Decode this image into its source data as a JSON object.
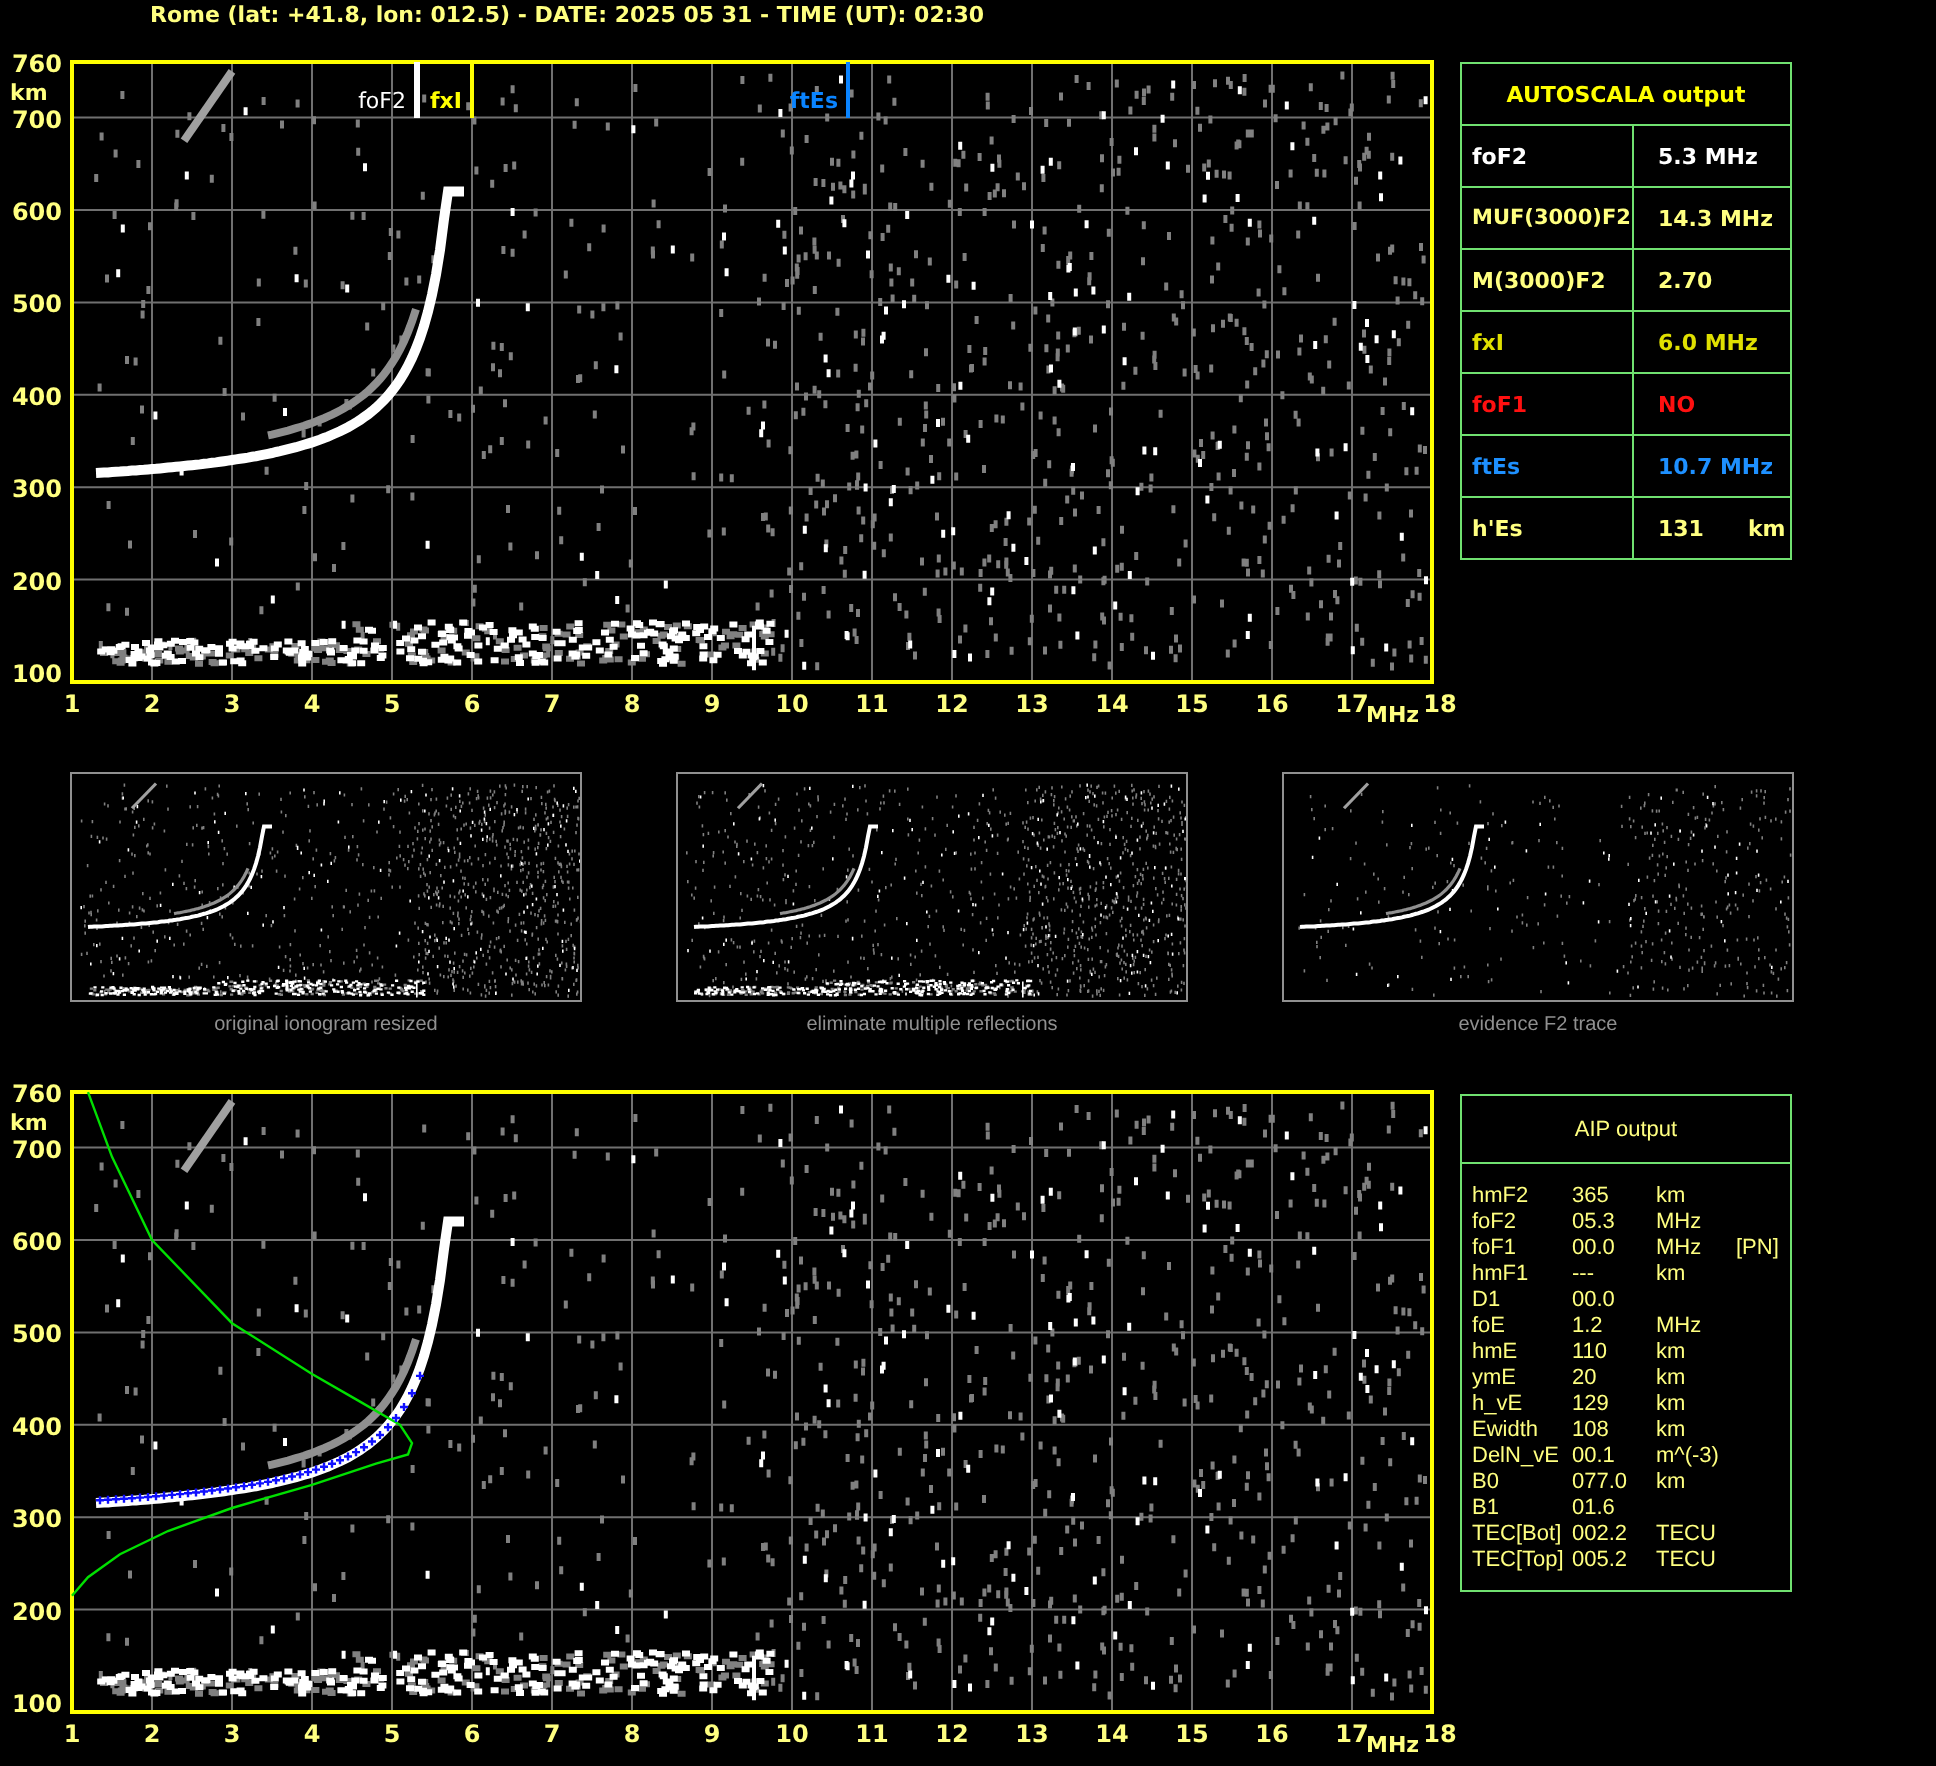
{
  "header": {
    "title": "Rome (lat: +41.8, lon: 012.5) - DATE: 2025 05 31 - TIME (UT): 02:30"
  },
  "top_plot": {
    "y_unit": "km",
    "x_unit": "MHz",
    "y_ticks": [
      "760",
      "700",
      "600",
      "500",
      "400",
      "300",
      "200",
      "100"
    ],
    "x_ticks": [
      "1",
      "2",
      "3",
      "4",
      "5",
      "6",
      "7",
      "8",
      "9",
      "10",
      "11",
      "12",
      "13",
      "14",
      "15",
      "16",
      "17",
      "18"
    ],
    "markers": [
      {
        "label": "foF2",
        "color": "#ffffff"
      },
      {
        "label": "fxI",
        "color": "#ffff00"
      },
      {
        "label": "ftEs",
        "color": "#0a84ff"
      }
    ]
  },
  "autoscala": {
    "title": "AUTOSCALA output",
    "rows": [
      {
        "label": "foF2",
        "value": "5.3 MHz",
        "color": "#ffffff"
      },
      {
        "label": "MUF(3000)F2",
        "value": "14.3 MHz",
        "color": "#ffff80"
      },
      {
        "label": "M(3000)F2",
        "value": "2.70",
        "color": "#ffff80"
      },
      {
        "label": "fxI",
        "value": "6.0 MHz",
        "color": "#e0e000"
      },
      {
        "label": "foF1",
        "value": "NO",
        "color": "#ff1010"
      },
      {
        "label": "ftEs",
        "value": "10.7 MHz",
        "color": "#1e90ff"
      },
      {
        "label": "h'Es",
        "value": "131",
        "unit": "km",
        "color": "#ffff80"
      }
    ]
  },
  "thumbnails": [
    {
      "kind": "original",
      "caption": "original ionogram resized"
    },
    {
      "kind": "filtered",
      "caption": "eliminate multiple reflections"
    },
    {
      "kind": "f2_trace",
      "caption": "evidence F2 trace"
    }
  ],
  "bottom_plot": {
    "y_unit": "km",
    "x_unit": "MHz",
    "y_ticks": [
      "760",
      "700",
      "600",
      "500",
      "400",
      "300",
      "200",
      "100"
    ],
    "x_ticks": [
      "1",
      "2",
      "3",
      "4",
      "5",
      "6",
      "7",
      "8",
      "9",
      "10",
      "11",
      "12",
      "13",
      "14",
      "15",
      "16",
      "17",
      "18"
    ]
  },
  "aip": {
    "title": "AIP output",
    "rows": [
      {
        "name": "hmF2",
        "value": "365",
        "unit": "km"
      },
      {
        "name": "foF2",
        "value": "05.3",
        "unit": "MHz"
      },
      {
        "name": "foF1",
        "value": "00.0",
        "unit": "MHz",
        "note": "[PN]"
      },
      {
        "name": "hmF1",
        "value": "---",
        "unit": "km"
      },
      {
        "name": "D1",
        "value": "00.0"
      },
      {
        "name": "foE",
        "value": "1.2",
        "unit": "MHz"
      },
      {
        "name": "hmE",
        "value": "110",
        "unit": "km"
      },
      {
        "name": "ymE",
        "value": "20",
        "unit": "km"
      },
      {
        "name": "h_vE",
        "value": "129",
        "unit": "km"
      },
      {
        "name": "Ewidth",
        "value": "108",
        "unit": "km"
      },
      {
        "name": "DelN_vE",
        "value": "00.1",
        "unit": "m^(-3)"
      },
      {
        "name": "B0",
        "value": "077.0",
        "unit": "km"
      },
      {
        "name": "B1",
        "value": "01.6"
      },
      {
        "name": "TEC[Bot]",
        "value": "002.2",
        "unit": "TECU"
      },
      {
        "name": "TEC[Top]",
        "value": "005.2",
        "unit": "TECU"
      }
    ]
  }
}
